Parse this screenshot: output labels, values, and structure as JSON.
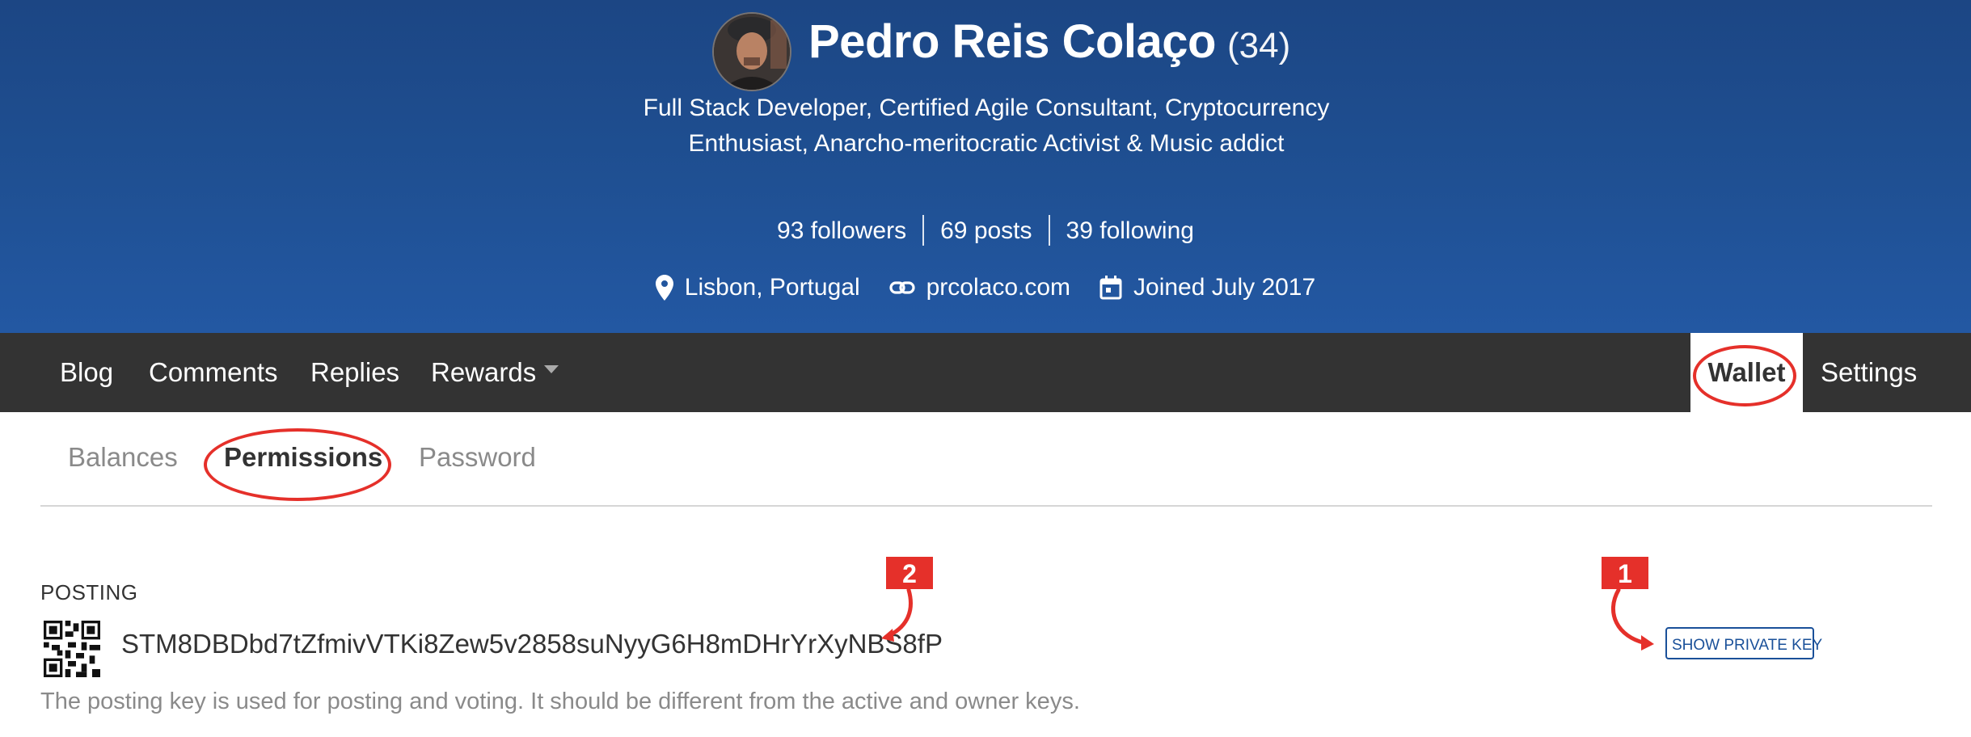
{
  "profile": {
    "name": "Pedro Reis Colaço",
    "reputation": "(34)",
    "bio": "Full Stack Developer, Certified Agile Consultant, Cryptocurrency Enthusiast, Anarcho-meritocratic Activist & Music addict",
    "stats": {
      "followers": "93 followers",
      "posts": "69 posts",
      "following": "39 following"
    },
    "location": "Lisbon, Portugal",
    "website": "prcolaco.com",
    "joined": "Joined July 2017"
  },
  "nav": {
    "blog": "Blog",
    "comments": "Comments",
    "replies": "Replies",
    "rewards": "Rewards",
    "wallet": "Wallet",
    "settings": "Settings",
    "active": "Wallet"
  },
  "subtabs": {
    "balances": "Balances",
    "permissions": "Permissions",
    "password": "Password",
    "active": "Permissions"
  },
  "posting": {
    "label": "POSTING",
    "public_key": "STM8DBDbd7tZfmivVTKi8Zew5v2858suNyyG6H8mDHrYrXyNBS8fP",
    "description": "The posting key is used for posting and voting. It should be different from the active and owner keys.",
    "show_private_key": "SHOW PRIVATE KEY"
  },
  "annotations": {
    "badge_1": "1",
    "badge_2": "2",
    "color": "#e5302a"
  },
  "colors": {
    "header_bg": "#1f5093",
    "nav_bg": "#333333",
    "link_blue": "#1a5099"
  },
  "icons": [
    "location-pin-icon",
    "link-icon",
    "calendar-icon",
    "caret-down-icon",
    "qr-code-icon"
  ]
}
